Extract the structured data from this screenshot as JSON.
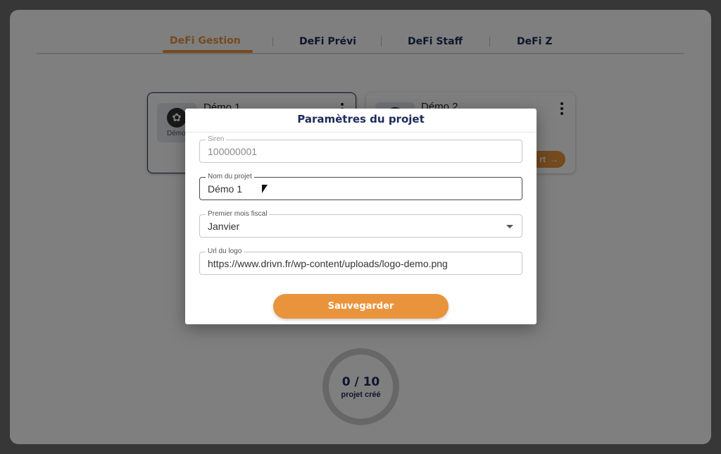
{
  "tabs": [
    {
      "label": "DeFi Gestion",
      "active": true
    },
    {
      "label": "DeFi Prévi"
    },
    {
      "label": "DeFi Staff"
    },
    {
      "label": "DeFi Z"
    }
  ],
  "cards": [
    {
      "title": "Démo 1",
      "logo_text": "Démo",
      "icon": "gear-icon"
    },
    {
      "title": "Démo 2",
      "open_label": "rt",
      "open_icon": "arrow-right-icon"
    }
  ],
  "counter": {
    "value": "0 / 10",
    "label": "projet créé"
  },
  "modal": {
    "title": "Paramètres du projet",
    "fields": {
      "siren": {
        "label": "Siren",
        "value": "100000001"
      },
      "name": {
        "label": "Nom du projet",
        "value": "Démo 1"
      },
      "fiscal_month": {
        "label": "Premier mois fiscal",
        "value": "Janvier"
      },
      "logo_url": {
        "label": "Url du logo",
        "value": "https://www.drivn.fr/wp-content/uploads/logo-demo.png"
      }
    },
    "save_label": "Sauvegarder"
  },
  "colors": {
    "accent": "#e9943c",
    "navy": "#1c2b5a"
  }
}
